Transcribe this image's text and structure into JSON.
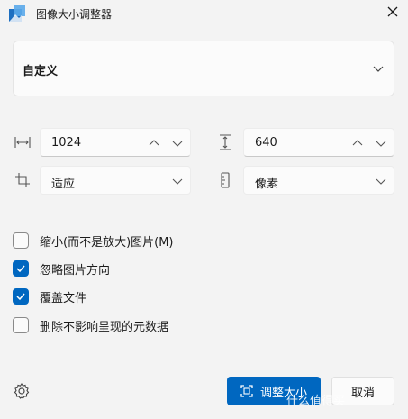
{
  "window": {
    "title": "图像大小调整器"
  },
  "preset": {
    "selected": "自定义"
  },
  "size": {
    "width_value": "1024",
    "height_value": "640",
    "fit_mode": "适应",
    "unit": "像素"
  },
  "options": [
    {
      "label": "缩小(而不是放大)图片(M)",
      "checked": false
    },
    {
      "label": "忽略图片方向",
      "checked": true
    },
    {
      "label": "覆盖文件",
      "checked": true
    },
    {
      "label": "删除不影响呈现的元数据",
      "checked": false
    }
  ],
  "footer": {
    "resize_label": "调整大小",
    "cancel_label": "取消"
  },
  "watermark": "什么值得买",
  "colors": {
    "accent": "#0067c0",
    "background": "#f3f3f3"
  }
}
